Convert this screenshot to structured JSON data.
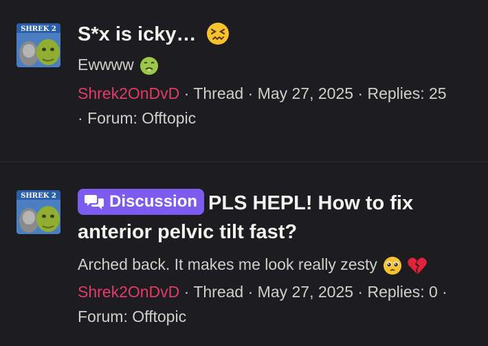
{
  "threads": [
    {
      "title": "S*x is icky…",
      "title_emoji": "confounded-face",
      "snippet": "Ewwww",
      "snippet_emoji": "nauseated-face",
      "author": "Shrek2OnDvD",
      "type": "Thread",
      "date": "May 27, 2025",
      "replies": "Replies: 25",
      "forum": "Forum: Offtopic",
      "avatar_text": "SHREK 2"
    },
    {
      "label": "Discussion",
      "label_icon": "chat-bubbles-icon",
      "title": "PLS HEPL! How to fix anterior pelvic tilt fast?",
      "snippet": "Arched back. It makes me look really zesty",
      "snippet_emojis": [
        "pleading-face",
        "broken-heart"
      ],
      "author": "Shrek2OnDvD",
      "type": "Thread",
      "date": "May 27, 2025",
      "replies": "Replies: 0",
      "forum": "Forum: Offtopic",
      "avatar_text": "SHREK 2"
    }
  ],
  "colors": {
    "background": "#1d1d1f",
    "username": "#e23b6a",
    "label_bg": "#7c5cf0"
  },
  "separator": "·"
}
